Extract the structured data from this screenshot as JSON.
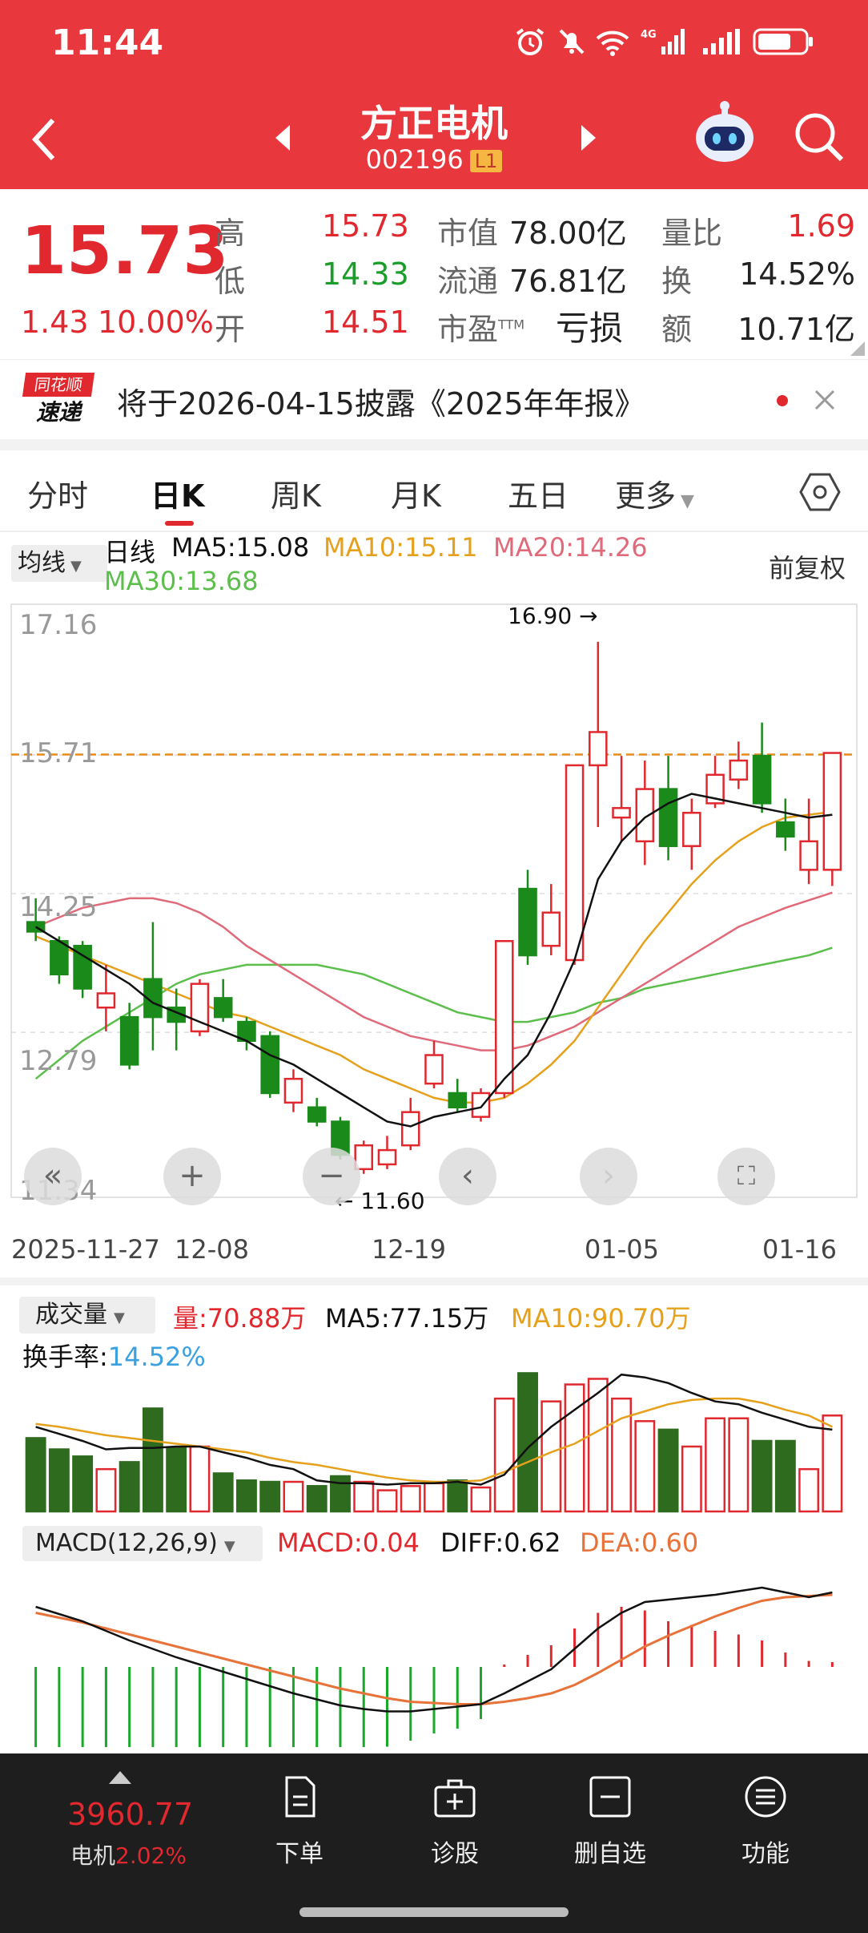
{
  "status_bar": {
    "time": "11:44",
    "network": "4G"
  },
  "header": {
    "title": "方正电机",
    "code": "002196",
    "level": "L1"
  },
  "quote": {
    "price": "15.73",
    "change": "1.43",
    "change_pct": "10.00%",
    "high_label": "高",
    "high": "15.73",
    "low_label": "低",
    "low": "14.33",
    "open_label": "开",
    "open": "14.51",
    "mcap_label": "市值",
    "mcap": "78.00亿",
    "float_label": "流通",
    "float": "76.81亿",
    "pe_label": "市盈",
    "pe_sup": "TTM",
    "pe": "亏损",
    "vol_ratio_label": "量比",
    "vol_ratio": "1.69",
    "turnover_label": "换",
    "turnover": "14.52%",
    "amount_label": "额",
    "amount": "10.71亿"
  },
  "notice": {
    "badge_top": "同花顺",
    "badge_bottom": "速递",
    "text": "将于2026-04-15披露《2025年年报》"
  },
  "tabs": [
    {
      "label": "分时"
    },
    {
      "label": "日K"
    },
    {
      "label": "周K"
    },
    {
      "label": "月K"
    },
    {
      "label": "五日"
    },
    {
      "label": "更多"
    }
  ],
  "kline": {
    "ma_selector": "均线",
    "period_label": "日线",
    "ma5": "MA5:15.08",
    "ma10": "MA10:15.11",
    "ma20": "MA20:14.26",
    "ma30": "MA30:13.68",
    "adjust": "前复权",
    "y_ticks": [
      "17.16",
      "15.71",
      "14.25",
      "12.79",
      "11.34"
    ],
    "high_marker": "16.90",
    "low_marker": "11.60",
    "x_ticks": [
      "2025-11-27",
      "12-08",
      "12-19",
      "01-05",
      "01-16"
    ],
    "colors": {
      "up": "#e0282e",
      "down": "#1a8a1a",
      "ma5": "#111111",
      "ma10": "#e6a11c",
      "ma20": "#e06a7a",
      "ma30": "#5cbf4c"
    }
  },
  "volume": {
    "selector": "成交量",
    "vol": "量:70.88万",
    "ma5": "MA5:77.15万",
    "ma10": "MA10:90.70万",
    "turnover_label": "换手率:",
    "turnover": "14.52%"
  },
  "macd": {
    "selector": "MACD(12,26,9)",
    "macd": "MACD:0.04",
    "diff": "DIFF:0.62",
    "dea": "DEA:0.60"
  },
  "bottom_nav": {
    "index_value": "3960.77",
    "index_name": "电机",
    "index_change": "2.02%",
    "items": [
      {
        "label": "下单"
      },
      {
        "label": "诊股"
      },
      {
        "label": "删自选"
      },
      {
        "label": "功能"
      }
    ]
  },
  "chart_data": {
    "type": "candlestick",
    "ylim": [
      11.34,
      17.16
    ],
    "candles": [
      {
        "o": 13.95,
        "c": 13.85,
        "h": 14.2,
        "l": 13.75
      },
      {
        "o": 13.75,
        "c": 13.4,
        "h": 13.8,
        "l": 13.3
      },
      {
        "o": 13.7,
        "c": 13.25,
        "h": 13.75,
        "l": 13.15
      },
      {
        "o": 13.05,
        "c": 13.2,
        "h": 13.5,
        "l": 12.8
      },
      {
        "o": 12.95,
        "c": 12.45,
        "h": 13.1,
        "l": 12.4
      },
      {
        "o": 13.35,
        "c": 12.95,
        "h": 13.95,
        "l": 12.6
      },
      {
        "o": 13.05,
        "c": 12.9,
        "h": 13.25,
        "l": 12.6
      },
      {
        "o": 12.8,
        "c": 13.3,
        "h": 13.35,
        "l": 12.75
      },
      {
        "o": 13.15,
        "c": 12.95,
        "h": 13.35,
        "l": 12.9
      },
      {
        "o": 12.9,
        "c": 12.7,
        "h": 12.95,
        "l": 12.6
      },
      {
        "o": 12.75,
        "c": 12.15,
        "h": 12.8,
        "l": 12.1
      },
      {
        "o": 12.05,
        "c": 12.3,
        "h": 12.4,
        "l": 11.95
      },
      {
        "o": 12.0,
        "c": 11.85,
        "h": 12.1,
        "l": 11.8
      },
      {
        "o": 11.85,
        "c": 11.5,
        "h": 11.9,
        "l": 11.45
      },
      {
        "o": 11.35,
        "c": 11.6,
        "h": 11.65,
        "l": 11.3
      },
      {
        "o": 11.4,
        "c": 11.55,
        "h": 11.7,
        "l": 11.35
      },
      {
        "o": 11.6,
        "c": 11.95,
        "h": 12.1,
        "l": 11.55
      },
      {
        "o": 12.25,
        "c": 12.55,
        "h": 12.7,
        "l": 12.2
      },
      {
        "o": 12.15,
        "c": 12.0,
        "h": 12.3,
        "l": 11.95
      },
      {
        "o": 11.9,
        "c": 12.15,
        "h": 12.2,
        "l": 11.85
      },
      {
        "o": 12.15,
        "c": 13.75,
        "h": 13.75,
        "l": 12.1
      },
      {
        "o": 14.3,
        "c": 13.6,
        "h": 14.5,
        "l": 13.5
      },
      {
        "o": 13.7,
        "c": 14.05,
        "h": 14.35,
        "l": 13.6
      },
      {
        "o": 13.55,
        "c": 15.6,
        "h": 15.6,
        "l": 13.5
      },
      {
        "o": 15.6,
        "c": 15.95,
        "h": 16.9,
        "l": 14.95
      },
      {
        "o": 15.05,
        "c": 15.15,
        "h": 15.7,
        "l": 14.8
      },
      {
        "o": 14.8,
        "c": 15.35,
        "h": 15.65,
        "l": 14.55
      },
      {
        "o": 15.35,
        "c": 14.75,
        "h": 15.7,
        "l": 14.6
      },
      {
        "o": 14.75,
        "c": 15.1,
        "h": 15.25,
        "l": 14.5
      },
      {
        "o": 15.2,
        "c": 15.5,
        "h": 15.7,
        "l": 15.15
      },
      {
        "o": 15.45,
        "c": 15.65,
        "h": 15.85,
        "l": 15.35
      },
      {
        "o": 15.7,
        "c": 15.2,
        "h": 16.05,
        "l": 15.1
      },
      {
        "o": 15.0,
        "c": 14.85,
        "h": 15.25,
        "l": 14.7
      },
      {
        "o": 14.5,
        "c": 14.8,
        "h": 15.25,
        "l": 14.35
      },
      {
        "o": 14.5,
        "c": 15.73,
        "h": 15.73,
        "l": 14.33
      }
    ],
    "ma5": [
      13.9,
      13.75,
      13.6,
      13.45,
      13.3,
      13.1,
      13.0,
      12.9,
      12.8,
      12.7,
      12.55,
      12.45,
      12.3,
      12.15,
      12.0,
      11.85,
      11.8,
      11.9,
      11.95,
      12.0,
      12.3,
      12.55,
      13.0,
      13.55,
      14.4,
      14.8,
      15.05,
      15.2,
      15.3,
      15.25,
      15.2,
      15.15,
      15.1,
      15.05,
      15.08
    ],
    "ma10": [
      13.8,
      13.7,
      13.6,
      13.5,
      13.4,
      13.3,
      13.2,
      13.1,
      13.0,
      12.95,
      12.85,
      12.75,
      12.65,
      12.55,
      12.4,
      12.3,
      12.2,
      12.1,
      12.05,
      12.05,
      12.1,
      12.25,
      12.45,
      12.7,
      13.05,
      13.4,
      13.75,
      14.05,
      14.35,
      14.6,
      14.8,
      14.95,
      15.05,
      15.08,
      15.11
    ],
    "ma20": [
      13.9,
      14.0,
      14.1,
      14.15,
      14.2,
      14.2,
      14.15,
      14.05,
      13.9,
      13.7,
      13.55,
      13.4,
      13.25,
      13.1,
      12.95,
      12.85,
      12.75,
      12.7,
      12.65,
      12.6,
      12.6,
      12.65,
      12.75,
      12.85,
      13.0,
      13.15,
      13.3,
      13.45,
      13.6,
      13.75,
      13.9,
      14.0,
      14.1,
      14.18,
      14.26
    ],
    "ma30": [
      12.3,
      12.5,
      12.7,
      12.85,
      13.0,
      13.15,
      13.3,
      13.4,
      13.45,
      13.5,
      13.5,
      13.5,
      13.5,
      13.45,
      13.4,
      13.3,
      13.2,
      13.1,
      13.0,
      12.95,
      12.9,
      12.9,
      12.95,
      13.0,
      13.1,
      13.15,
      13.25,
      13.3,
      13.35,
      13.4,
      13.45,
      13.5,
      13.55,
      13.6,
      13.68
    ],
    "volume": [
      0.52,
      0.44,
      0.39,
      0.3,
      0.35,
      0.73,
      0.45,
      0.46,
      0.27,
      0.22,
      0.21,
      0.21,
      0.18,
      0.25,
      0.21,
      0.15,
      0.18,
      0.2,
      0.22,
      0.17,
      0.8,
      0.98,
      0.78,
      0.9,
      0.94,
      0.8,
      0.64,
      0.58,
      0.46,
      0.66,
      0.66,
      0.5,
      0.5,
      0.3,
      0.68
    ],
    "volume_ma5": [
      0.6,
      0.55,
      0.5,
      0.44,
      0.45,
      0.45,
      0.46,
      0.46,
      0.42,
      0.38,
      0.33,
      0.3,
      0.22,
      0.2,
      0.2,
      0.19,
      0.2,
      0.2,
      0.21,
      0.19,
      0.26,
      0.45,
      0.6,
      0.72,
      0.84,
      0.97,
      0.95,
      0.91,
      0.84,
      0.78,
      0.76,
      0.7,
      0.65,
      0.6,
      0.58
    ],
    "volume_ma10": [
      0.62,
      0.6,
      0.57,
      0.54,
      0.52,
      0.5,
      0.48,
      0.46,
      0.44,
      0.42,
      0.38,
      0.35,
      0.33,
      0.3,
      0.27,
      0.24,
      0.22,
      0.21,
      0.21,
      0.22,
      0.28,
      0.35,
      0.42,
      0.48,
      0.57,
      0.66,
      0.71,
      0.76,
      0.79,
      0.8,
      0.8,
      0.77,
      0.72,
      0.68,
      0.6
    ],
    "macd_hist": [
      -0.45,
      -0.45,
      -0.44,
      -0.44,
      -0.43,
      -0.43,
      -0.42,
      -0.42,
      -0.41,
      -0.41,
      -0.4,
      -0.4,
      -0.38,
      -0.37,
      -0.35,
      -0.33,
      -0.28,
      -0.22,
      -0.18,
      -0.1,
      0.02,
      0.1,
      0.18,
      0.32,
      0.45,
      0.5,
      0.47,
      0.38,
      0.35,
      0.3,
      0.27,
      0.22,
      0.12,
      0.05,
      0.04
    ],
    "macd_diff": [
      0.5,
      0.44,
      0.38,
      0.3,
      0.22,
      0.15,
      0.08,
      0.02,
      -0.04,
      -0.1,
      -0.16,
      -0.22,
      -0.27,
      -0.32,
      -0.35,
      -0.37,
      -0.37,
      -0.35,
      -0.33,
      -0.31,
      -0.22,
      -0.12,
      -0.02,
      0.15,
      0.32,
      0.45,
      0.54,
      0.56,
      0.58,
      0.6,
      0.63,
      0.66,
      0.62,
      0.58,
      0.62
    ],
    "macd_dea": [
      0.45,
      0.41,
      0.37,
      0.32,
      0.27,
      0.22,
      0.17,
      0.12,
      0.07,
      0.02,
      -0.03,
      -0.08,
      -0.13,
      -0.18,
      -0.22,
      -0.26,
      -0.29,
      -0.3,
      -0.31,
      -0.31,
      -0.29,
      -0.26,
      -0.22,
      -0.15,
      -0.05,
      0.06,
      0.17,
      0.26,
      0.34,
      0.42,
      0.49,
      0.55,
      0.58,
      0.59,
      0.6
    ]
  }
}
